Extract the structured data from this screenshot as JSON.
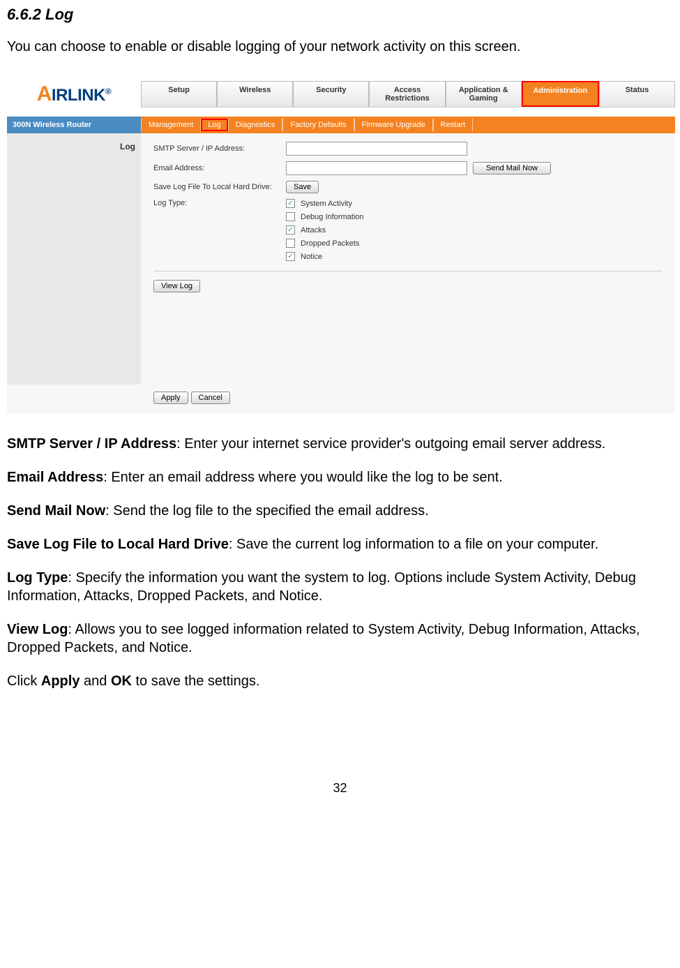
{
  "section": {
    "heading": "6.6.2 Log",
    "intro": "You can choose to enable or disable logging of your network activity on this screen."
  },
  "router_ui": {
    "subnav_left": "300N Wireless Router",
    "sidebar_label": "Log",
    "tabs": [
      "Setup",
      "Wireless",
      "Security",
      "Access Restrictions",
      "Application & Gaming",
      "Administration",
      "Status"
    ],
    "subnav": [
      "Management",
      "Log",
      "Diagnostics",
      "Factory Defaults",
      "Firmware Upgrade",
      "Restart"
    ],
    "form": {
      "smtp_label": "SMTP Server / IP Address:",
      "email_label": "Email Address:",
      "send_mail_btn": "Send Mail Now",
      "save_local_label": "Save Log File To Local Hard Drive:",
      "save_btn": "Save",
      "log_type_label": "Log Type:",
      "options": [
        {
          "label": "System Activity",
          "checked": true
        },
        {
          "label": "Debug Information",
          "checked": false
        },
        {
          "label": "Attacks",
          "checked": true
        },
        {
          "label": "Dropped Packets",
          "checked": false
        },
        {
          "label": "Notice",
          "checked": true
        }
      ],
      "view_log_btn": "View Log",
      "apply_btn": "Apply",
      "cancel_btn": "Cancel"
    }
  },
  "descriptions": {
    "smtp": {
      "term": "SMTP Server / IP Address",
      "text": ":  Enter your internet service provider's outgoing email server address."
    },
    "email": {
      "term": "Email Address",
      "text": ": Enter an email address where you would like the log to be sent."
    },
    "send_now": {
      "term": "Send Mail Now",
      "text": ": Send the log file to the specified the email address."
    },
    "save_local": {
      "term": "Save Log File to Local Hard Drive",
      "text": ": Save the current log information to a file on your computer."
    },
    "log_type": {
      "term": "Log Type",
      "text": ": Specify the information you want the system to log. Options include System Activity, Debug Information, Attacks, Dropped Packets, and Notice."
    },
    "view_log": {
      "term": "View Log",
      "text": ": Allows you to see logged information related to System Activity, Debug Information, Attacks, Dropped Packets, and Notice."
    },
    "apply_ok": {
      "pre": "Click ",
      "apply": "Apply",
      "mid": " and ",
      "ok": "OK",
      "post": " to save the settings."
    }
  },
  "page_number": "32"
}
